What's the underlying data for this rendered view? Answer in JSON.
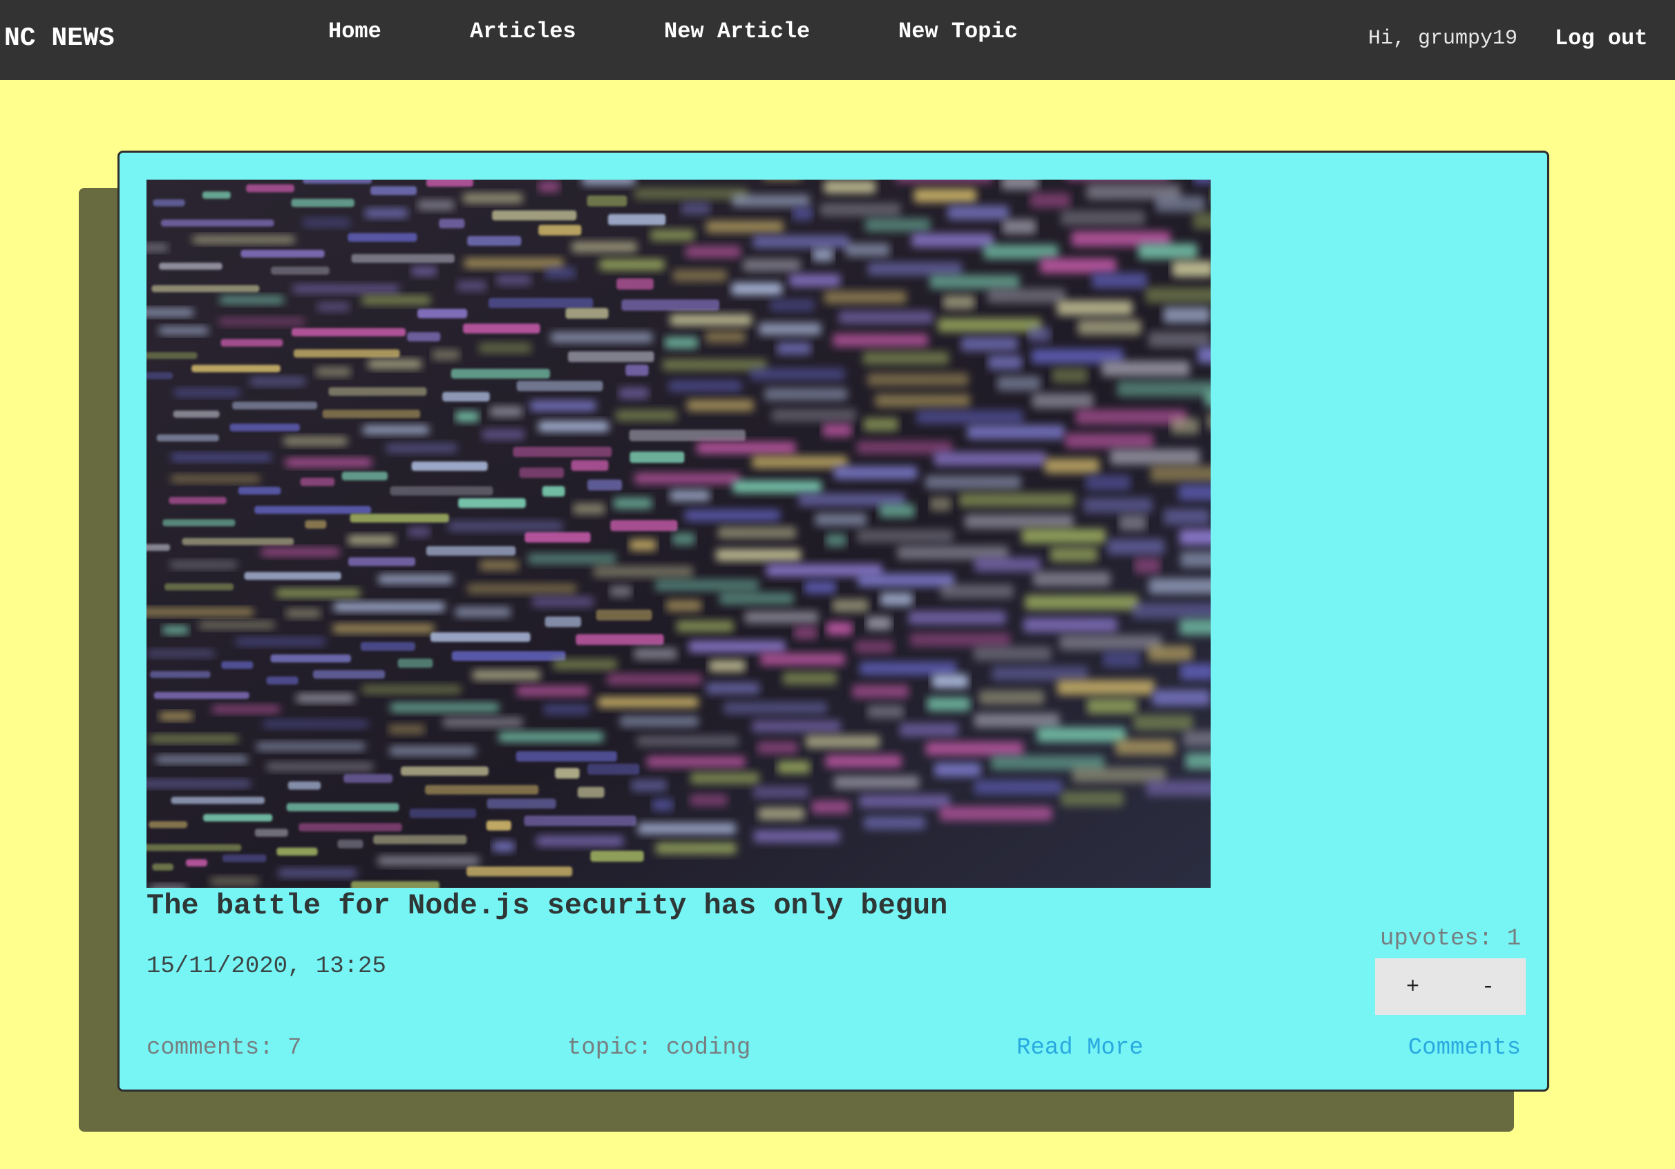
{
  "nav": {
    "brand": "NC NEWS",
    "links": [
      {
        "label": "Home"
      },
      {
        "label": "Articles"
      },
      {
        "label": "New Article"
      },
      {
        "label": "New Topic"
      }
    ],
    "greeting": "Hi, grumpy19",
    "logout": "Log out"
  },
  "article": {
    "image_alt": "code on a monitor",
    "title": "The battle for Node.js security has only begun",
    "date": "15/11/2020, 13:25",
    "upvotes": "upvotes: 1",
    "vote_up_label": "+",
    "vote_down_label": "-",
    "comments_count": "comments: 7",
    "topic": "topic: coding",
    "read_more": "Read More",
    "comments_link": "Comments"
  },
  "colors": {
    "navbar": "#333333",
    "page_background": "#ffff8e",
    "card_background": "#77f5f5",
    "card_shadow": "#686a3f",
    "link": "#2aa9e0"
  }
}
